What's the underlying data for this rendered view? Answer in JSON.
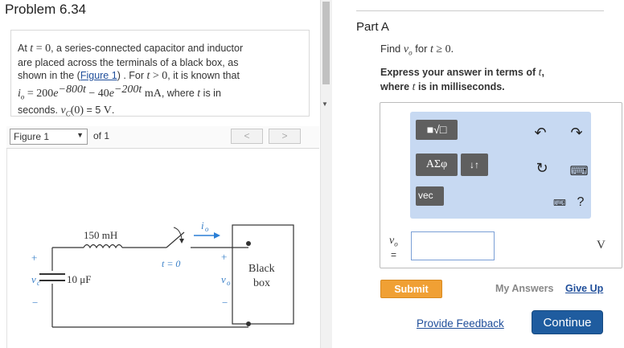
{
  "problem": {
    "title": "Problem 6.34",
    "text_l1_a": "At ",
    "text_l1_t": "t",
    "text_l1_eq": " = 0",
    "text_l1_b": ", a series-connected capacitor and inductor",
    "text_l2": "are placed across the terminals of a black box, as",
    "text_l3_a": "shown in the (",
    "figure_link": "Figure 1",
    "text_l3_b": ") . For ",
    "text_l3_t": "t",
    "text_l3_gt": " > 0",
    "text_l3_c": ", it is known that",
    "io_var": "i",
    "io_sub": "o",
    "io_eq": " = 200",
    "e1": "e",
    "exp1": "−800t",
    "minus": " − 40",
    "e2": "e",
    "exp2": "−200t",
    "unit_ma": " mA",
    "text_l4_b": ", where ",
    "text_l4_t": "t",
    "text_l4_c": " is in",
    "text_l5_a": "seconds. ",
    "vc_var": "v",
    "vc_sub": "C",
    "vc_arg": "(0)",
    "text_l5_b": " = 5 ",
    "text_l5_v": "V",
    "text_l5_c": "."
  },
  "figure_nav": {
    "selected": "Figure 1",
    "of_label": "of 1",
    "prev": "<",
    "next": ">"
  },
  "circuit": {
    "inductor_label": "150 mH",
    "cap_label": "10 μF",
    "vc_plus": "+",
    "vc_label": "v",
    "vc_sub": "c",
    "vc_minus": "−",
    "switch_label": "t = 0",
    "io_label": "i",
    "io_sub": "o",
    "vo_plus": "+",
    "vo_label": "v",
    "vo_sub": "o",
    "vo_minus": "−",
    "box_line1": "Black",
    "box_line2": "box"
  },
  "part": {
    "title": "Part A",
    "find_a": "Find ",
    "find_var": "v",
    "find_sub": "o",
    "find_b": " for ",
    "find_t": "t",
    "find_c": " ≥ 0.",
    "instr_a": "Express your answer in terms of ",
    "instr_t": "t",
    "instr_b": ",",
    "instr_c": "where ",
    "instr_t2": "t",
    "instr_d": " is in milliseconds."
  },
  "toolbar": {
    "template_btn": "■√□",
    "greek_btn": "ΑΣφ",
    "arrows_btn": "↓↑",
    "vec_btn": "vec",
    "undo": "↶",
    "redo": "↷",
    "reset": "↻",
    "keyboard": "⌨",
    "help": "?",
    "shortcut": "⌨"
  },
  "answer": {
    "var": "v",
    "sub": "o",
    "eq": "=",
    "value": "",
    "unit": "V"
  },
  "actions": {
    "submit": "Submit",
    "my_answers": "My Answers",
    "give_up": "Give Up",
    "feedback": "Provide Feedback",
    "continue": "Continue"
  },
  "colors": {
    "link": "#1f4e9a",
    "submit": "#f0a034",
    "continue": "#1f5c9f",
    "toolbar_bg": "#c7d9f2",
    "current_arrow": "#2a7fd6"
  }
}
